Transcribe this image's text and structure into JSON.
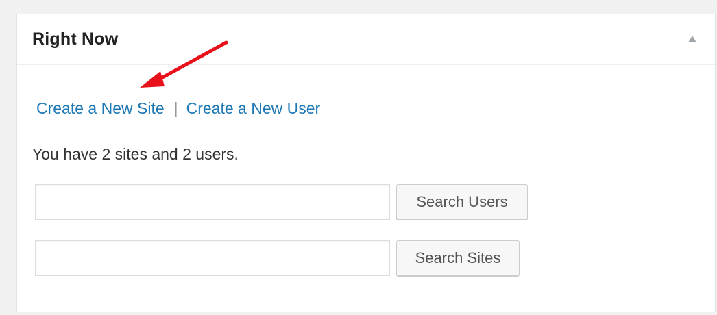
{
  "widget": {
    "title": "Right Now",
    "collapse_icon": "triangle-up-icon"
  },
  "links": {
    "create_site": "Create a New Site",
    "separator": "|",
    "create_user": "Create a New User"
  },
  "summary": "You have 2 sites and 2 users.",
  "search_users": {
    "value": "",
    "button_label": "Search Users"
  },
  "search_sites": {
    "value": "",
    "button_label": "Search Sites"
  },
  "annotation": {
    "arrow_color": "#e8111b",
    "arrow_icon": "red-arrow-icon"
  },
  "colors": {
    "link": "#1e78b4",
    "background": "#f1f1f1",
    "panel": "#ffffff"
  }
}
